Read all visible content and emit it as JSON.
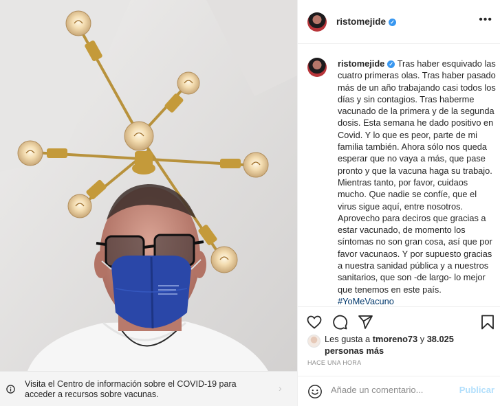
{
  "post": {
    "username": "ristomejide",
    "caption": "Tras haber esquivado las cuatro primeras olas. Tras haber pasado más de un año trabajando casi todos los días y sin contagios. Tras haberme vacunado de la primera y de la segunda dosis. Esta semana he dado positivo en Covid. Y lo que es peor, parte de mi familia también. Ahora sólo nos queda esperar que no vaya a más, que pase pronto y que la vacuna haga su trabajo. Mientras tanto, por favor, cuidaos mucho. Que nadie se confíe, que el virus sigue aquí, entre nosotros. Aprovecho para deciros que gracias a estar vacunado, de momento los síntomas no son gran cosa, así que por favor vacunaos. Y por supuesto gracias a nuestra sanidad pública y a nuestros sanitarios, que son -de largo- lo mejor que tenemos en este país.",
    "hashtag": "#YoMeVacuno",
    "likes_prefix": "Les gusta a",
    "liker": "tmoreno73",
    "likes_suffix": "y",
    "likes_count": "38.025 personas más",
    "time": "HACE UNA HORA"
  },
  "covid_banner": {
    "text": "Visita el Centro de información sobre el COVID-19 para acceder a recursos sobre vacunas."
  },
  "comment_box": {
    "placeholder": "Añade un comentario...",
    "publish_label": "Publicar"
  },
  "icons": {
    "more": "more-options-icon",
    "like": "heart-icon",
    "comment": "comment-icon",
    "share": "share-icon",
    "save": "bookmark-icon",
    "emoji": "emoji-icon",
    "verified": "verified-badge-icon",
    "info": "info-icon",
    "chevron": "chevron-right-icon"
  },
  "colors": {
    "verified": "#3897f0",
    "hashtag": "#00376b",
    "publish_disabled": "#b2dffc",
    "muted": "#8e8e8e",
    "mask": "#2a47a8"
  }
}
